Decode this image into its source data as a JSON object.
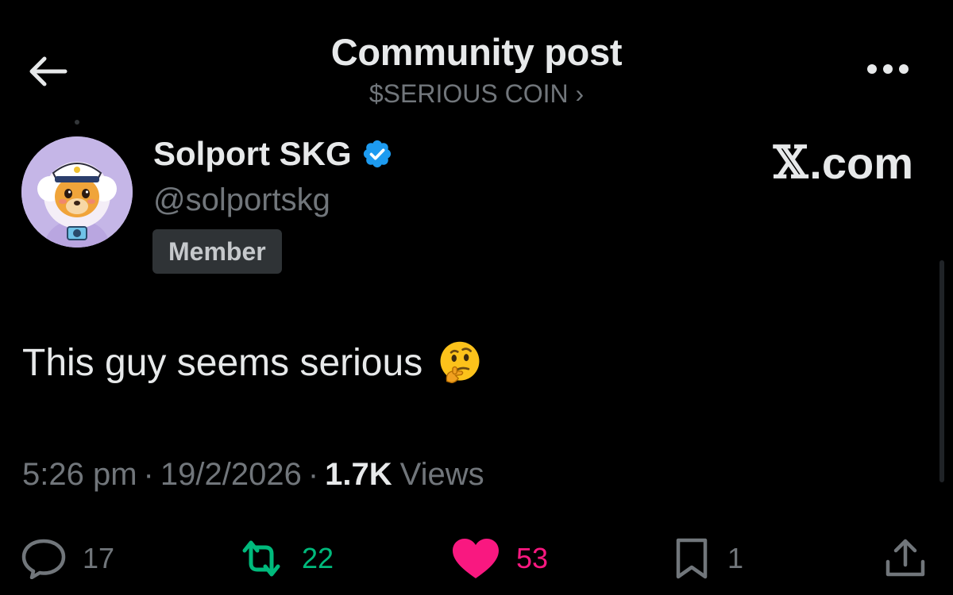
{
  "header": {
    "title": "Community post",
    "community": "$SERIOUS COIN ›"
  },
  "author": {
    "display_name": "Solport SKG",
    "handle": "@solportskg",
    "badge": "Member",
    "verified": true
  },
  "watermark": {
    "x_letter": "𝕏",
    "domain": ".com"
  },
  "post": {
    "text": "This guy seems serious",
    "emoji": "thinking-face"
  },
  "meta": {
    "time": "5:26 pm",
    "separator": "·",
    "date": "19/2/2026",
    "views_count": "1.7K",
    "views_label": "Views"
  },
  "actions": {
    "replies": "17",
    "reposts": "22",
    "likes": "53",
    "bookmarks": "1"
  },
  "colors": {
    "background": "#000000",
    "primary_text": "#e7e9ea",
    "secondary_text": "#71767b",
    "verified": "#1d9bf0",
    "repost_active": "#00ba7c",
    "like_active": "#f91880",
    "badge_bg": "#2f3336"
  },
  "icons": {
    "back": "arrow-left-icon",
    "more": "more-horizontal-icon",
    "verified": "verified-check-icon",
    "reply": "speech-bubble-icon",
    "repost": "repost-arrows-icon",
    "like": "heart-filled-icon",
    "bookmark": "bookmark-icon",
    "share": "share-upload-icon"
  }
}
